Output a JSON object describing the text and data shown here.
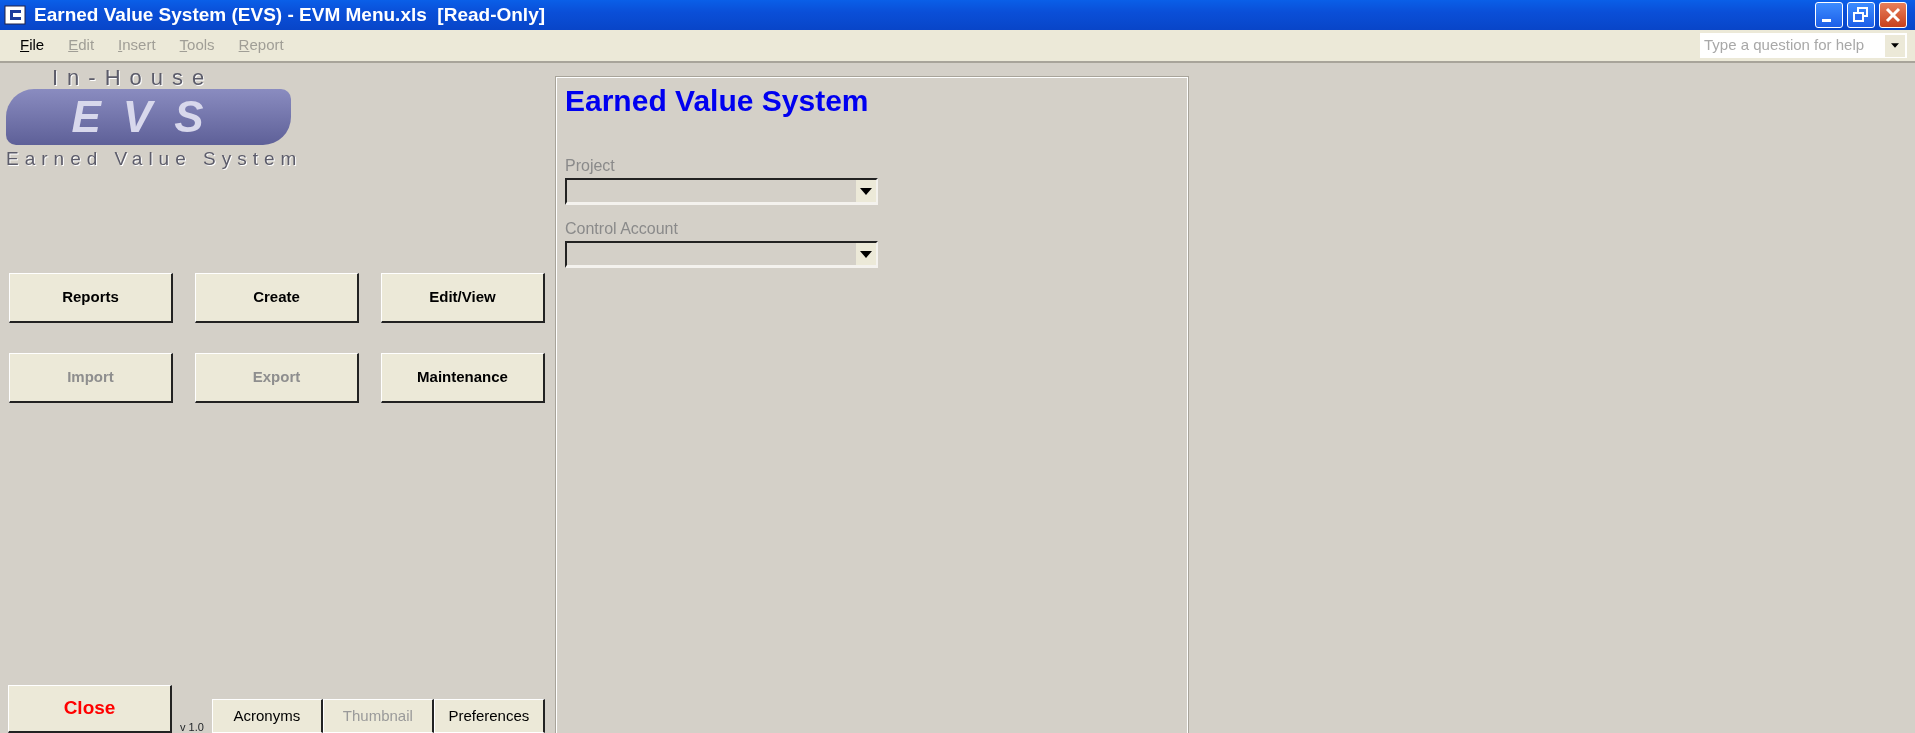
{
  "window": {
    "title": "Earned Value System (EVS) - EVM Menu.xls  [Read-Only]"
  },
  "menu": [
    {
      "label": "File",
      "disabled": false
    },
    {
      "label": "Edit",
      "disabled": true
    },
    {
      "label": "Insert",
      "disabled": true
    },
    {
      "label": "Tools",
      "disabled": true
    },
    {
      "label": "Report",
      "disabled": true
    }
  ],
  "help_box": {
    "placeholder": "Type a question for help"
  },
  "logo": {
    "top": "In-House",
    "mark": "EVS",
    "bottom": "Earned Value System"
  },
  "buttons": [
    {
      "label": "Reports",
      "disabled": false
    },
    {
      "label": "Create",
      "disabled": false
    },
    {
      "label": "Edit/View",
      "disabled": false
    },
    {
      "label": "Import",
      "disabled": true
    },
    {
      "label": "Export",
      "disabled": true
    },
    {
      "label": "Maintenance",
      "disabled": false
    }
  ],
  "close_button": {
    "label": "Close"
  },
  "version": "v 1.0",
  "bottom_buttons": [
    {
      "label": "Acronyms",
      "disabled": false
    },
    {
      "label": "Thumbnail",
      "disabled": true
    },
    {
      "label": "Preferences",
      "disabled": false
    }
  ],
  "panel": {
    "title": "Earned Value System",
    "fields": [
      {
        "label": "Project",
        "disabled": true
      },
      {
        "label": "Control Account",
        "disabled": true
      }
    ]
  }
}
